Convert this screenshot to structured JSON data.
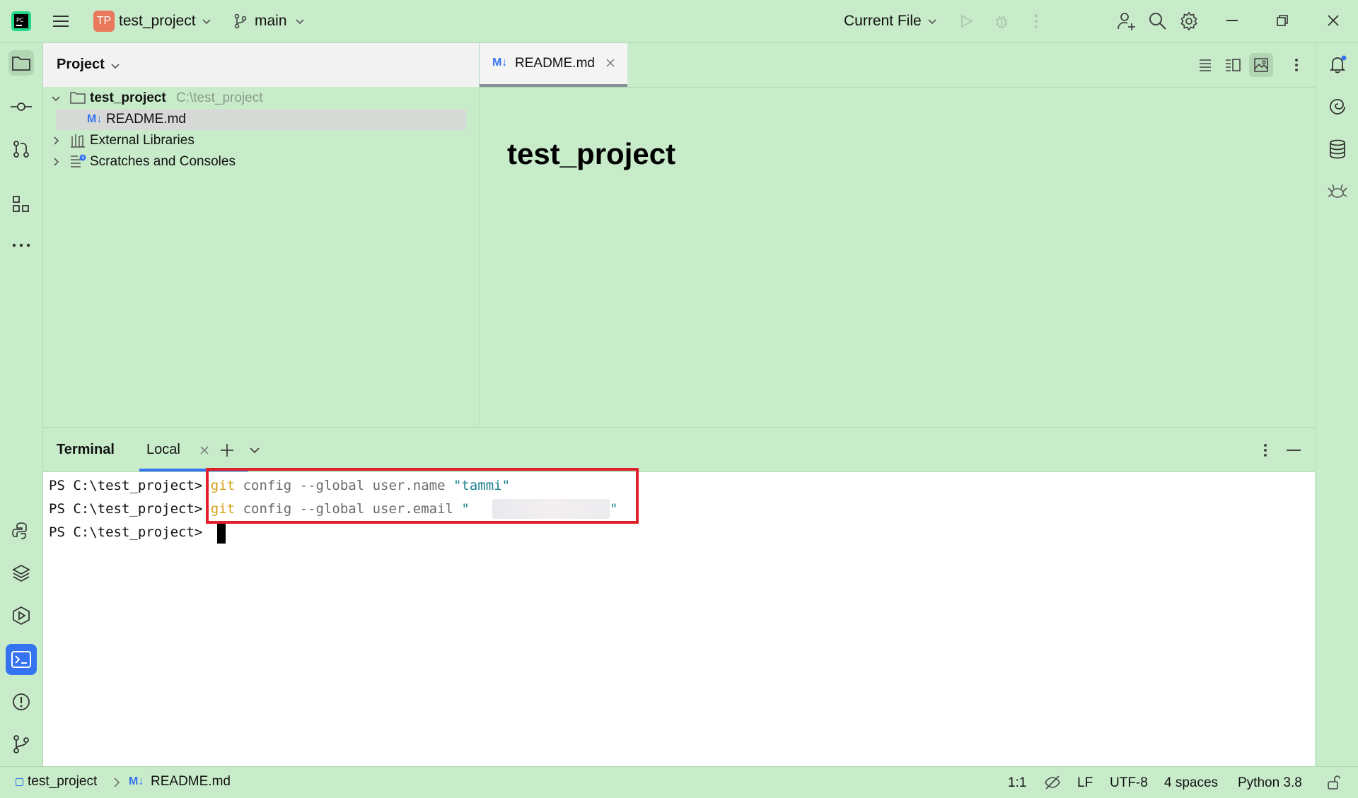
{
  "titlebar": {
    "logo_text": "PC",
    "project_badge": "TP",
    "project_name": "test_project",
    "branch": "main",
    "run_config": "Current File"
  },
  "project_panel": {
    "title": "Project",
    "tree": [
      {
        "label": "test_project",
        "path": "C:\\test_project"
      },
      {
        "label": "README.md"
      },
      {
        "label": "External Libraries"
      },
      {
        "label": "Scratches and Consoles"
      }
    ]
  },
  "editor": {
    "tab_label": "README.md",
    "md_badge": "M↓",
    "heading": "test_project"
  },
  "terminal": {
    "title": "Terminal",
    "tab_label": "Local",
    "prompt": "PS C:\\test_project>",
    "lines": [
      {
        "cmd": "git",
        "rest": " config --global user.name ",
        "arg": "\"tammi\""
      },
      {
        "cmd": "git",
        "rest": " config --global user.email ",
        "arg_open": "\"",
        "arg_close": "\""
      }
    ]
  },
  "statusbar": {
    "breadcrumb_project": "test_project",
    "breadcrumb_file": "README.md",
    "position": "1:1",
    "line_sep": "LF",
    "encoding": "UTF-8",
    "indent": "4 spaces",
    "interpreter": "Python 3.8"
  },
  "colors": {
    "background": "#c8ecca",
    "highlight_box": "#e0202a",
    "git_keyword": "#d4a017",
    "string": "#1a7f8e",
    "active_tool": "#3574f0"
  }
}
